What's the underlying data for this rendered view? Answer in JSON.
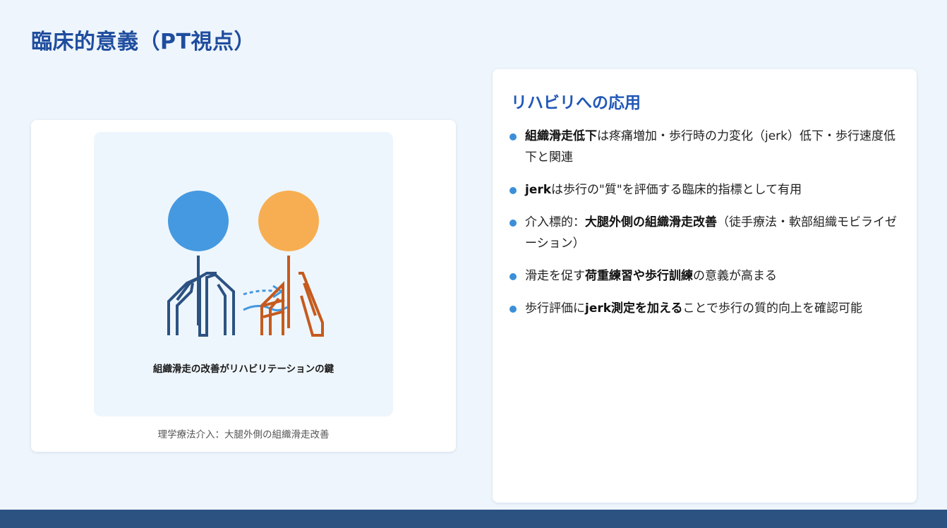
{
  "slide": {
    "title": "臨床的意義（PT視点）"
  },
  "illustration": {
    "caption": "組織滑走の改善がリハビリテーションの鍵",
    "figure_caption": "理学療法介入：大腿外側の組織滑走改善",
    "colors": {
      "left_head": "#4599e0",
      "right_head": "#f7ae52",
      "left_body": "#2c5282",
      "right_body": "#c65a1e",
      "flow": "#4599e0"
    }
  },
  "applications": {
    "title": "リハビリへの応用",
    "items": [
      {
        "parts": [
          {
            "t": "組織滑走低下",
            "b": true
          },
          {
            "t": "は疼痛増加・歩行時の力変化（jerk）低下・歩行速度低下と関連",
            "b": false
          }
        ]
      },
      {
        "parts": [
          {
            "t": "jerk",
            "b": true
          },
          {
            "t": "は歩行の\"質\"を評価する臨床的指標として有用",
            "b": false
          }
        ]
      },
      {
        "parts": [
          {
            "t": "介入標的：",
            "b": false
          },
          {
            "t": "大腿外側の組織滑走改善",
            "b": true
          },
          {
            "t": "（徒手療法・軟部組織モビライゼーション）",
            "b": false
          }
        ]
      },
      {
        "parts": [
          {
            "t": "滑走を促す",
            "b": false
          },
          {
            "t": "荷重練習や歩行訓練",
            "b": true
          },
          {
            "t": "の意義が高まる",
            "b": false
          }
        ]
      },
      {
        "parts": [
          {
            "t": "歩行評価に",
            "b": false
          },
          {
            "t": "jerk測定を加える",
            "b": true
          },
          {
            "t": "ことで歩行の質的向上を確認可能",
            "b": false
          }
        ]
      }
    ]
  },
  "accent_color": "#3b8fd8",
  "footer_color": "#2c5282"
}
